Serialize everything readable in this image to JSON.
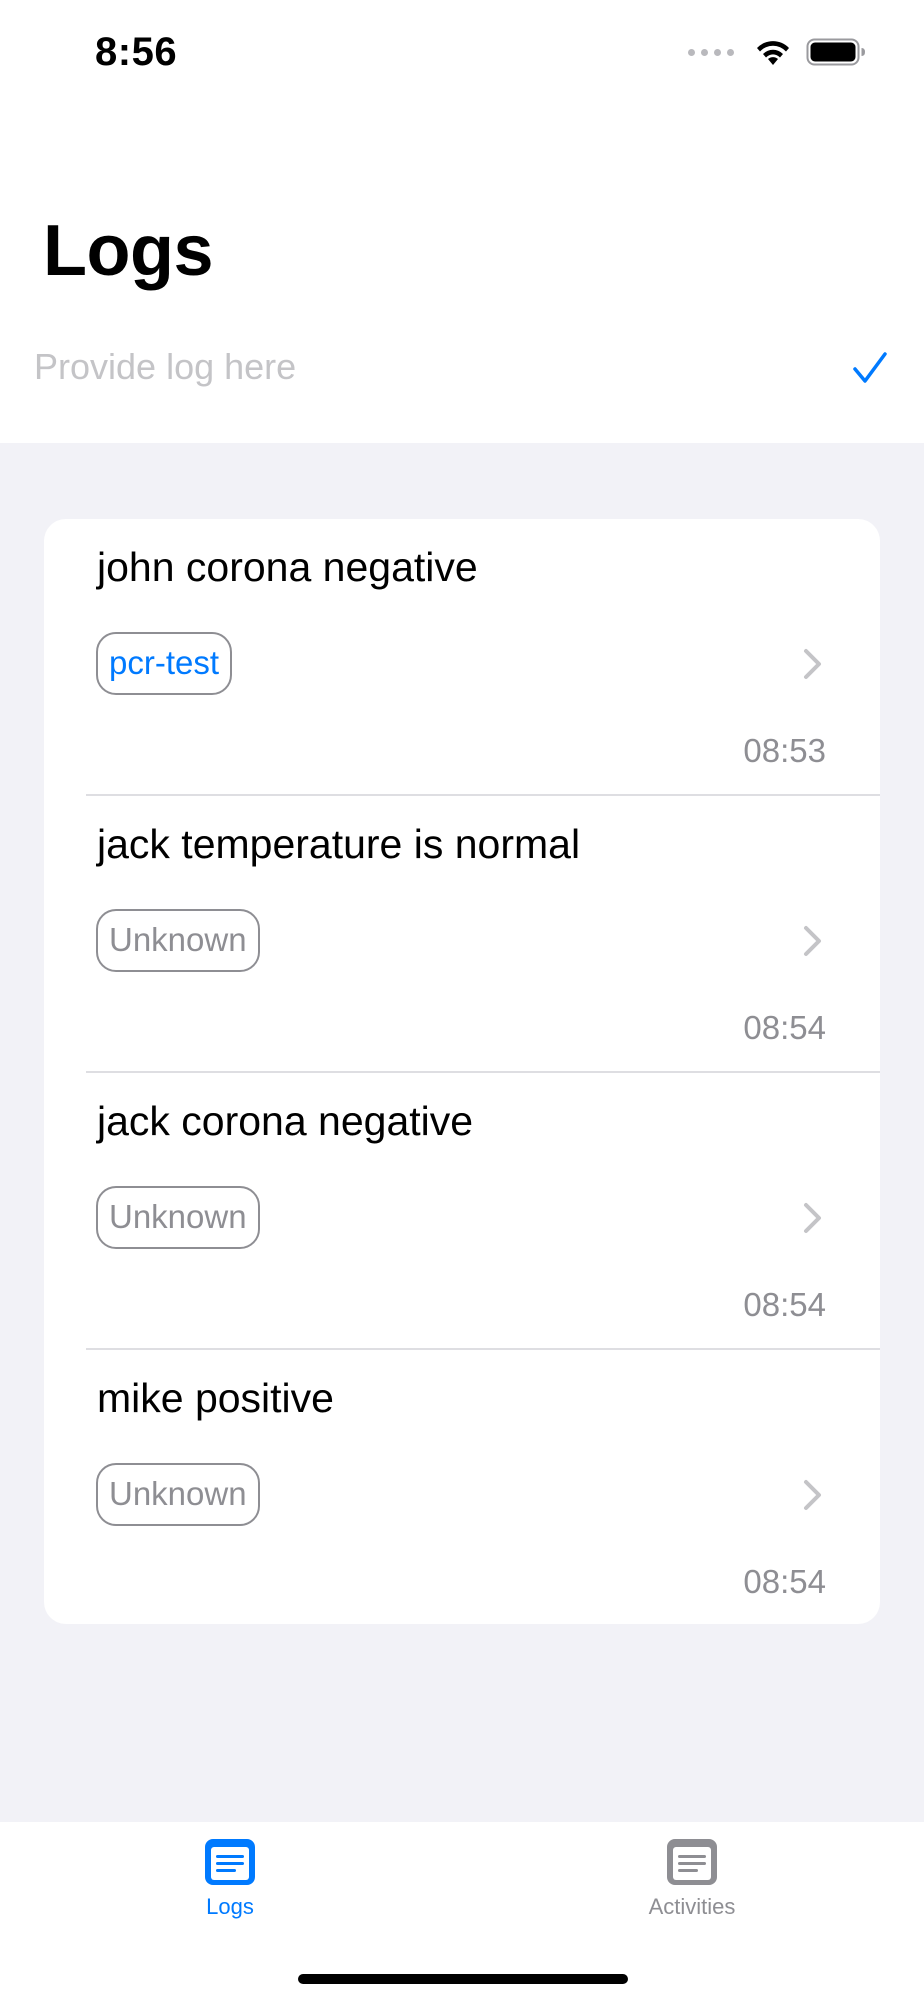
{
  "status_bar": {
    "time": "8:56"
  },
  "header": {
    "title": "Logs"
  },
  "log_input": {
    "placeholder": "Provide log here",
    "value": ""
  },
  "logs": [
    {
      "text": "john corona negative",
      "tag": "pcr-test",
      "time": "08:53"
    },
    {
      "text": "jack temperature is normal",
      "tag": "Unknown",
      "time": "08:54"
    },
    {
      "text": "jack corona negative",
      "tag": "Unknown",
      "time": "08:54"
    },
    {
      "text": "mike positive",
      "tag": "Unknown",
      "time": "08:54"
    }
  ],
  "tab_bar": {
    "tabs": [
      {
        "label": "Logs",
        "icon": "doc-text-icon",
        "selected": true
      },
      {
        "label": "Activities",
        "icon": "doc-text-icon",
        "selected": false
      }
    ]
  },
  "colors": {
    "accent": "#007aff",
    "secondary_text": "#8e8e93",
    "background": "#f2f2f7"
  }
}
